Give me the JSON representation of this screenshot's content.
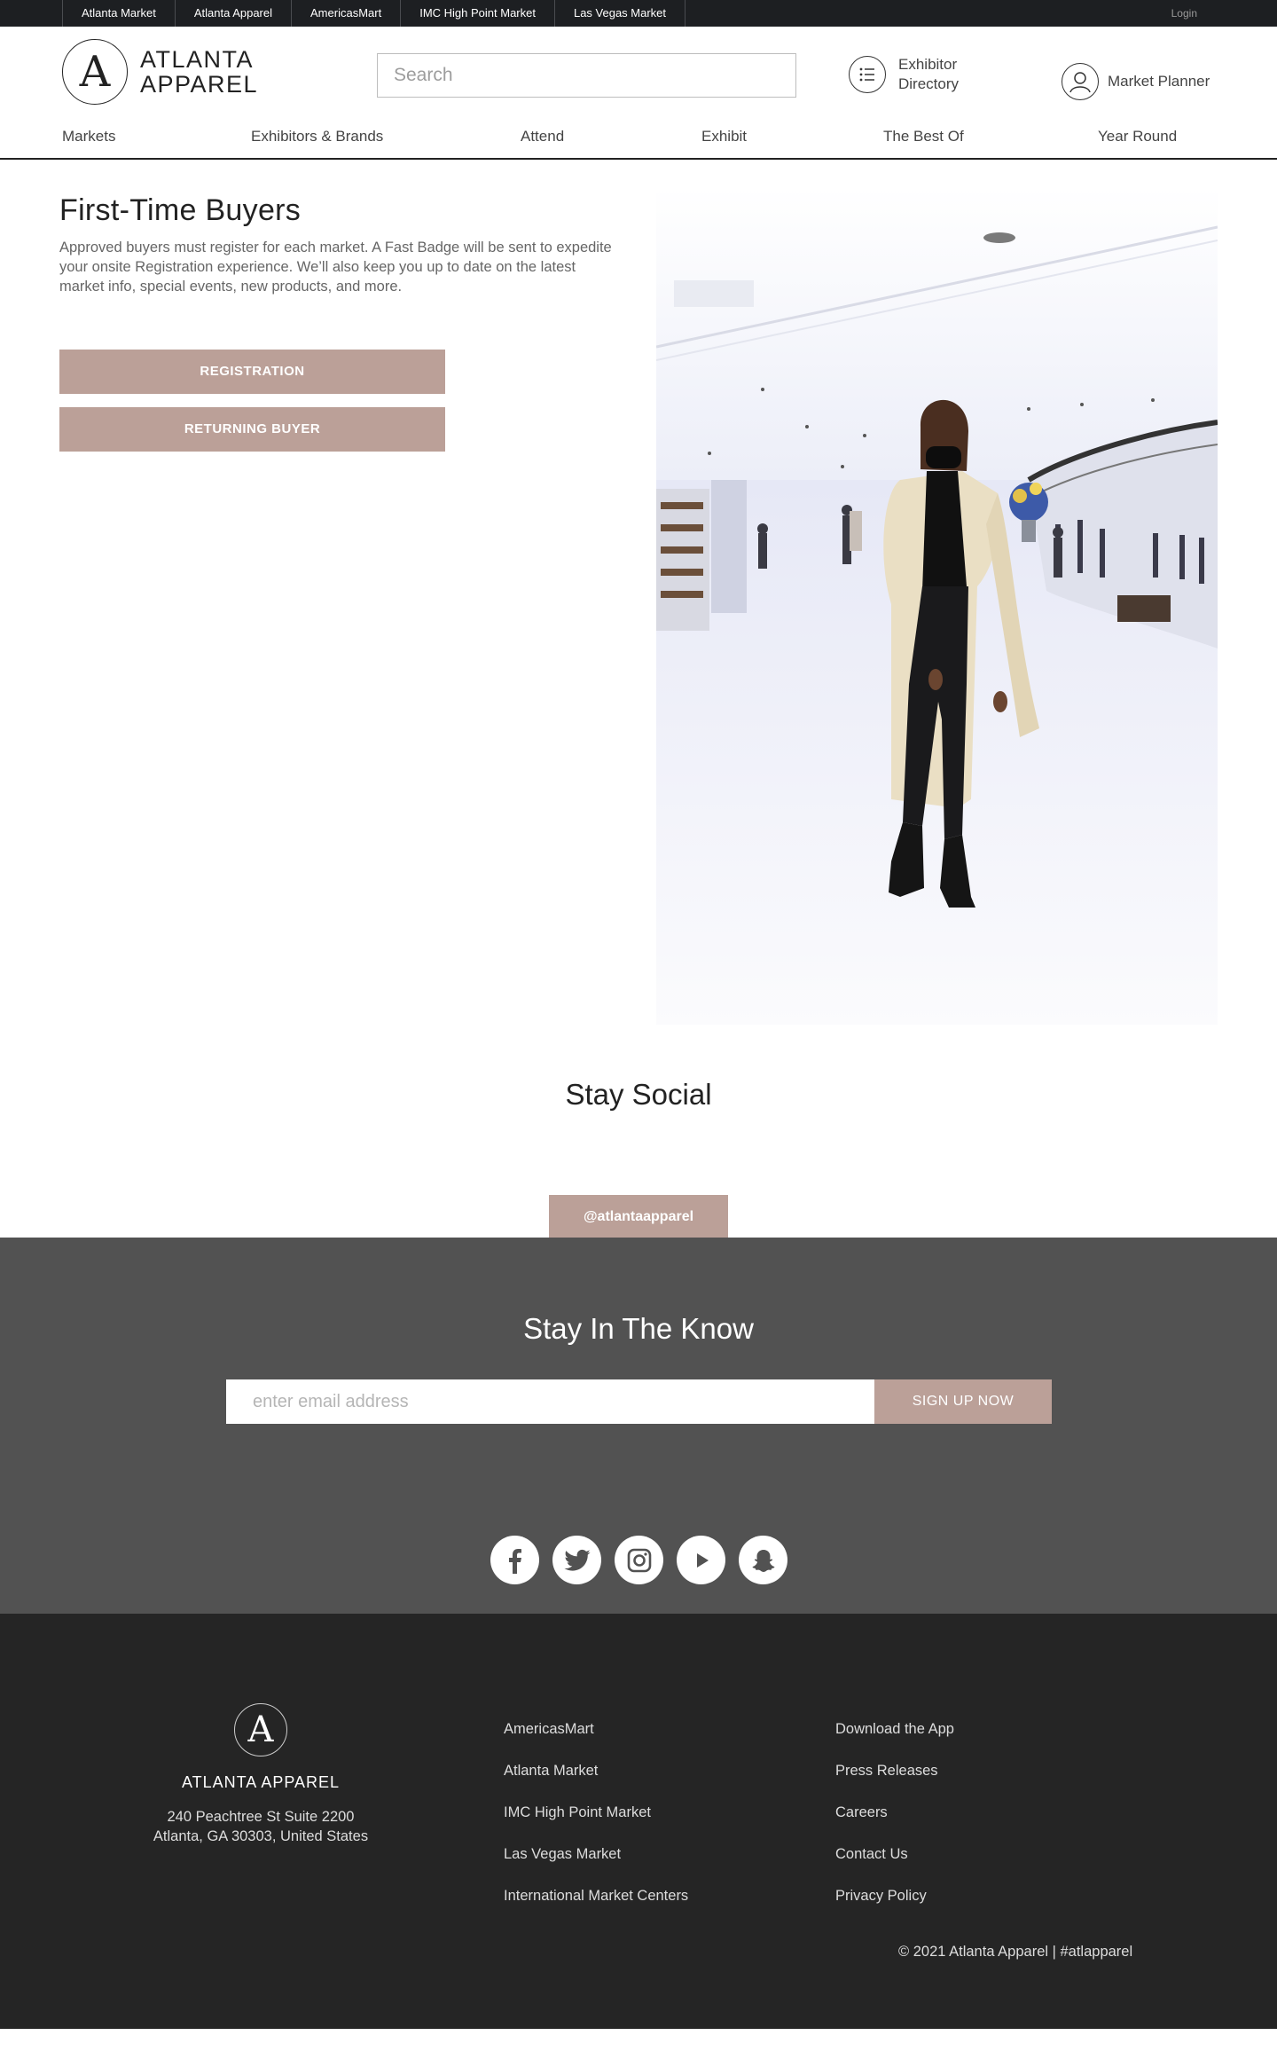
{
  "topbar": {
    "sites": [
      "Atlanta Market",
      "Atlanta Apparel",
      "AmericasMart",
      "IMC High Point Market",
      "Las Vegas Market"
    ],
    "login": "Login"
  },
  "header": {
    "logo_letter": "A",
    "logo_line1": "ATLANTA",
    "logo_line2": "APPAREL",
    "search_placeholder": "Search",
    "exhibitor_directory_line1": "Exhibitor",
    "exhibitor_directory_line2": "Directory",
    "market_planner": "Market Planner"
  },
  "nav": {
    "items": [
      "Markets",
      "Exhibitors & Brands",
      "Attend",
      "Exhibit",
      "The Best Of",
      "Year Round"
    ]
  },
  "main": {
    "title": "First-Time Buyers",
    "intro": "Approved buyers must register for each market. A Fast Badge will be sent to expedite your onsite Registration experience. We’ll also keep you up to date on the latest market info, special events, new products, and more.",
    "registration_button": "REGISTRATION",
    "returning_buyer_button": "RETURNING BUYER"
  },
  "social": {
    "title": "Stay Social",
    "handle_button": "@atlantaapparel"
  },
  "newsletter": {
    "title": "Stay In The Know",
    "email_placeholder": "enter email address",
    "signup_button": "SIGN UP NOW",
    "icons": [
      "facebook-icon",
      "twitter-icon",
      "instagram-icon",
      "youtube-icon",
      "snapchat-icon"
    ]
  },
  "footer": {
    "logo_letter": "A",
    "name": "ATLANTA APPAREL",
    "address_line1": "240 Peachtree St Suite 2200",
    "address_line2": "Atlanta, GA 30303, United States",
    "col1": [
      "AmericasMart",
      "Atlanta Market",
      "IMC High Point Market",
      "Las Vegas Market",
      "International Market Centers"
    ],
    "col2": [
      "Download the App",
      "Press Releases",
      "Careers",
      "Contact Us",
      "Privacy Policy"
    ],
    "copyright": "© 2021 Atlanta Apparel | #atlapparel"
  },
  "colors": {
    "accent": "#bba098",
    "topbar": "#1d1f22",
    "newsletter_bg": "#525252",
    "footer_bg": "#252525"
  }
}
